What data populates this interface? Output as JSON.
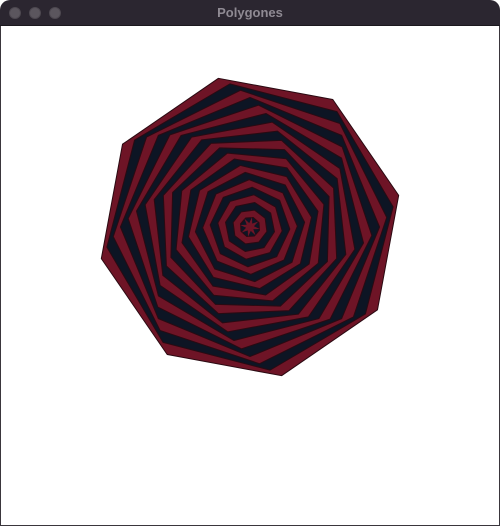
{
  "window": {
    "title": "Polygones"
  },
  "controls": {
    "close": "close-button",
    "minimize": "minimize-button",
    "maximize": "maximize-button"
  },
  "colors": {
    "titlebar": "#2b2630",
    "traffic_light": "#5b565e",
    "title_text": "#8f8a93",
    "background": "#ffffff",
    "polygon_fill_a": "#6e1426",
    "polygon_fill_b": "#0d1524",
    "polygon_stroke": "#2a0a12"
  },
  "figure": {
    "shape": "octagon",
    "sides": 8,
    "layers": 20,
    "rotation_step_degrees": 4
  }
}
